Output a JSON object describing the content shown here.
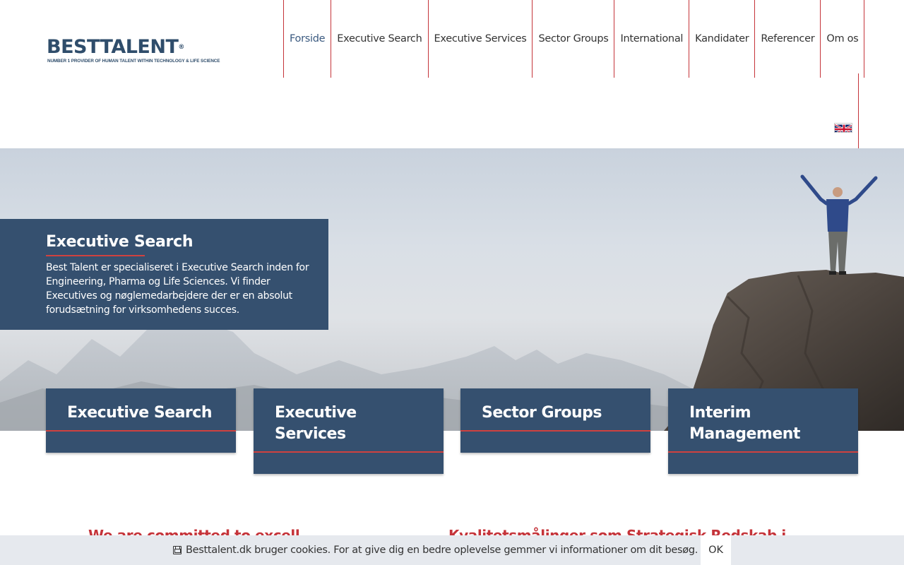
{
  "logo": {
    "main": "BESTTALENT",
    "reg": "®",
    "tagline": "NUMBER 1 PROVIDER OF HUMAN TALENT WITHIN TECHNOLOGY & LIFE SCIENCE"
  },
  "nav": {
    "items": [
      "Forside",
      "Executive Search",
      "Executive Services",
      "Sector Groups",
      "International",
      "Kandidater",
      "Referencer",
      "Om os"
    ],
    "active": "Forside",
    "language_flag": "uk-flag-icon"
  },
  "hero": {
    "title": "Executive Search",
    "text": "Best Talent er specialiseret i Executive Search inden for Engineering, Pharma og Life Sciences. Vi finder Executives og nøglemedarbejdere der er en absolut forudsætning for virksomhedens succes."
  },
  "cards": [
    {
      "title": "Executive Search"
    },
    {
      "title": "Executive Services"
    },
    {
      "title": "Sector Groups"
    },
    {
      "title": "Interim Management"
    }
  ],
  "sections": {
    "left_heading": "We are committed to excell",
    "right_heading": "Kvalitetsmålinger som Strategisk Redskab i"
  },
  "cookie": {
    "text": "Besttalent.dk bruger cookies. For at give dig en bedre oplevelse gemmer vi informationer om dit besøg.",
    "ok_label": "OK"
  },
  "colors": {
    "navy": "#35506f",
    "accent_red": "#c5343a",
    "cookie_bg": "#e6e9ee"
  }
}
